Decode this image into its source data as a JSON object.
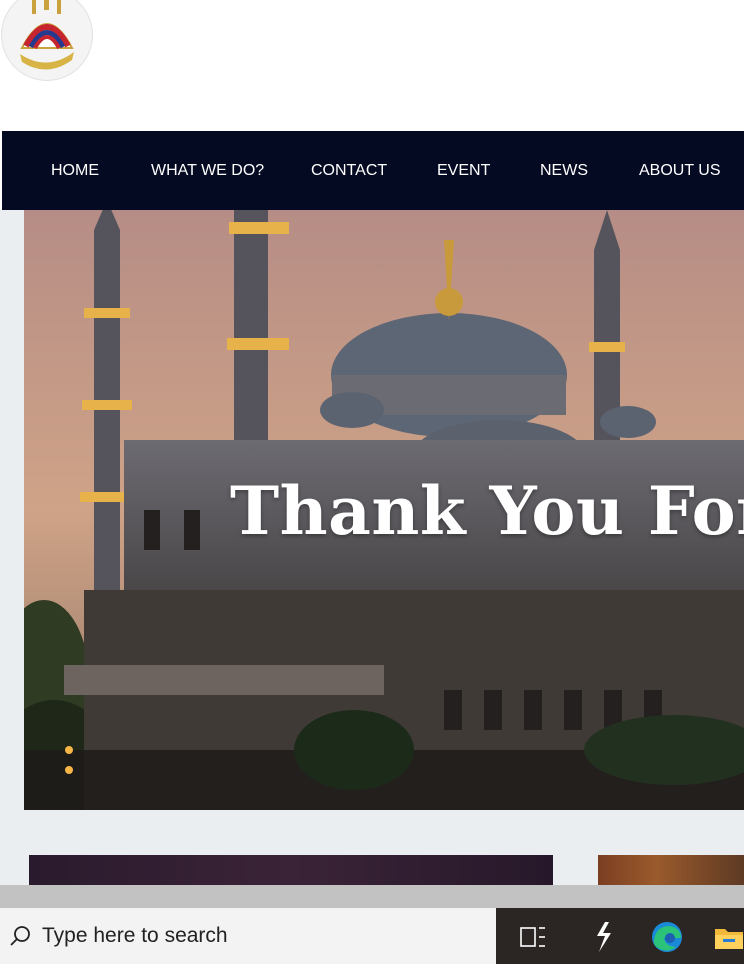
{
  "nav": {
    "items": [
      {
        "label": "HOME"
      },
      {
        "label": "WHAT WE DO?"
      },
      {
        "label": "CONTACT"
      },
      {
        "label": "EVENT"
      },
      {
        "label": "NEWS"
      },
      {
        "label": "ABOUT US"
      }
    ]
  },
  "hero": {
    "title": "Thank You For V"
  },
  "taskbar": {
    "search_placeholder": "Type here to search",
    "icons": [
      "task-view-icon",
      "app-icon",
      "edge-browser-icon",
      "file-explorer-icon"
    ]
  },
  "colors": {
    "nav_bg": "#050a23",
    "page_bg": "#eaeef0",
    "taskbar_bg": "#2b2523"
  }
}
